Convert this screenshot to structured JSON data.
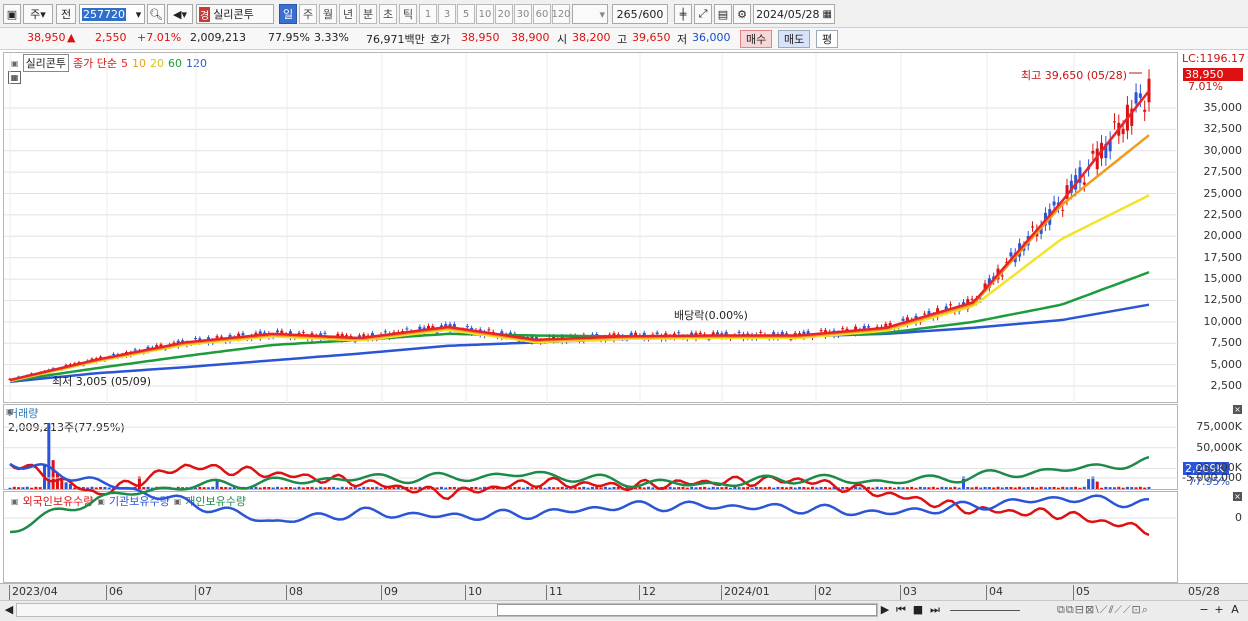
{
  "toolbar": {
    "market": "주",
    "prev": "전",
    "code": "257720",
    "name": "실리콘투",
    "name_badge": "경",
    "periods": [
      "일",
      "주",
      "월",
      "년",
      "분",
      "초",
      "틱"
    ],
    "intervals": [
      "1",
      "3",
      "5",
      "10",
      "20",
      "30",
      "60",
      "120"
    ],
    "count": "265",
    "count_max": "/600",
    "date": "2024/05/28"
  },
  "quote": {
    "price": "38,950",
    "arrow": "▲",
    "change": "2,550",
    "change_pct": "+7.01%",
    "volume": "2,009,213",
    "vol_ratio": "77.95%",
    "turnover": "3.33%",
    "amount": "76,971백만",
    "bid_label": "호가",
    "ask": "38,950",
    "bid": "38,900",
    "open_label": "시",
    "open": "38,200",
    "high_label": "고",
    "high": "39,650",
    "low_label": "저",
    "low": "36,000",
    "buy": "매수",
    "sell": "매도",
    "extra": "평"
  },
  "price_panel": {
    "name": "실리콘투",
    "legend_prefix": "종가 단순",
    "ma": [
      {
        "label": "5",
        "color": "#e8232a"
      },
      {
        "label": "10",
        "color": "#f39a1c"
      },
      {
        "label": "20",
        "color": "#f5e32a"
      },
      {
        "label": "60",
        "color": "#1e9b3b"
      },
      {
        "label": "120",
        "color": "#2b55d6"
      }
    ],
    "lc": "LC:1196.17",
    "last_price": "38,950",
    "last_pct": "7.01%",
    "high_note": "최고 39,650 (05/28)",
    "low_note": "최저 3,005 (05/09)",
    "dividend_note": "배당락(0.00%)",
    "yticks": [
      "35,000",
      "32,500",
      "30,000",
      "27,500",
      "25,000",
      "22,500",
      "20,000",
      "17,500",
      "15,000",
      "12,500",
      "10,000",
      "7,500",
      "5,000",
      "2,500"
    ]
  },
  "volume_panel": {
    "title": "거래량",
    "current": "2,009,213주(77.95%)",
    "yticks": [
      "75,000K",
      "50,000K",
      "25,000K"
    ],
    "last_volume": "2,009K",
    "last_pct": "77.95%"
  },
  "holding_panel": {
    "series": [
      {
        "name": "외국인보유수량",
        "color": "#d11"
      },
      {
        "name": "기관보유수량",
        "color": "#2b55d6"
      },
      {
        "name": "개인보유수량",
        "color": "#1e8a4a"
      }
    ],
    "yticks": [
      "0",
      "-5,000,000"
    ]
  },
  "xaxis": {
    "labels": [
      "2023/04",
      "06",
      "07",
      "08",
      "09",
      "10",
      "11",
      "12",
      "2024/01",
      "02",
      "03",
      "04",
      "05"
    ],
    "last_date": "05/28"
  },
  "chart_data": {
    "type": "line",
    "title": "실리콘투",
    "x": [
      "2023/04",
      "06",
      "07",
      "08",
      "09",
      "10",
      "11",
      "12",
      "2024/01",
      "02",
      "03",
      "04",
      "05",
      "05/28"
    ],
    "series": [
      {
        "name": "5",
        "values": [
          3200,
          5600,
          7600,
          8600,
          8100,
          9400,
          7900,
          8300,
          8400,
          8400,
          9300,
          12300,
          24000,
          37000
        ]
      },
      {
        "name": "60",
        "values": [
          3100,
          4600,
          6000,
          7300,
          7900,
          8600,
          8400,
          8300,
          8200,
          8300,
          8700,
          10000,
          12000,
          15800
        ]
      },
      {
        "name": "120",
        "values": [
          3000,
          4000,
          4700,
          5500,
          6300,
          7200,
          7600,
          8000,
          8200,
          8300,
          8600,
          9300,
          10200,
          12000
        ]
      }
    ],
    "ylim": [
      0,
      40000
    ]
  }
}
